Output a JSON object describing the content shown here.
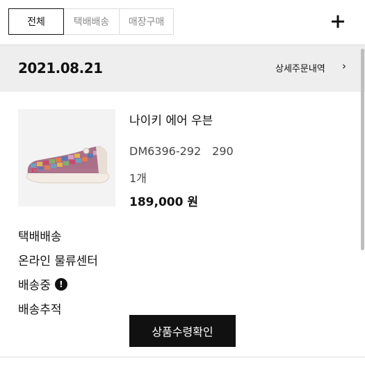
{
  "filter": {
    "tabs": [
      "전체",
      "택배배송",
      "매장구매"
    ],
    "active": "전체"
  },
  "header": {
    "add_icon": "plus-icon"
  },
  "order": {
    "date": "2021.08.21",
    "detail_link": "상세주문내역",
    "chevron": "›"
  },
  "product": {
    "name": "나이키 에어 우븐",
    "code": "DM6396-292",
    "size": "290",
    "qty": "1개",
    "price": "189,000 원"
  },
  "shipping": {
    "method": "택배배송",
    "center": "온라인 물류센터",
    "status": "배송중",
    "status_icon": "alert-icon",
    "tracking": "배송추적"
  },
  "actions": {
    "confirm": "상품수령확인"
  },
  "colors": {
    "primary": "#111111",
    "date_bar_bg": "#eeeeee",
    "muted_text": "#8a8a8a"
  }
}
